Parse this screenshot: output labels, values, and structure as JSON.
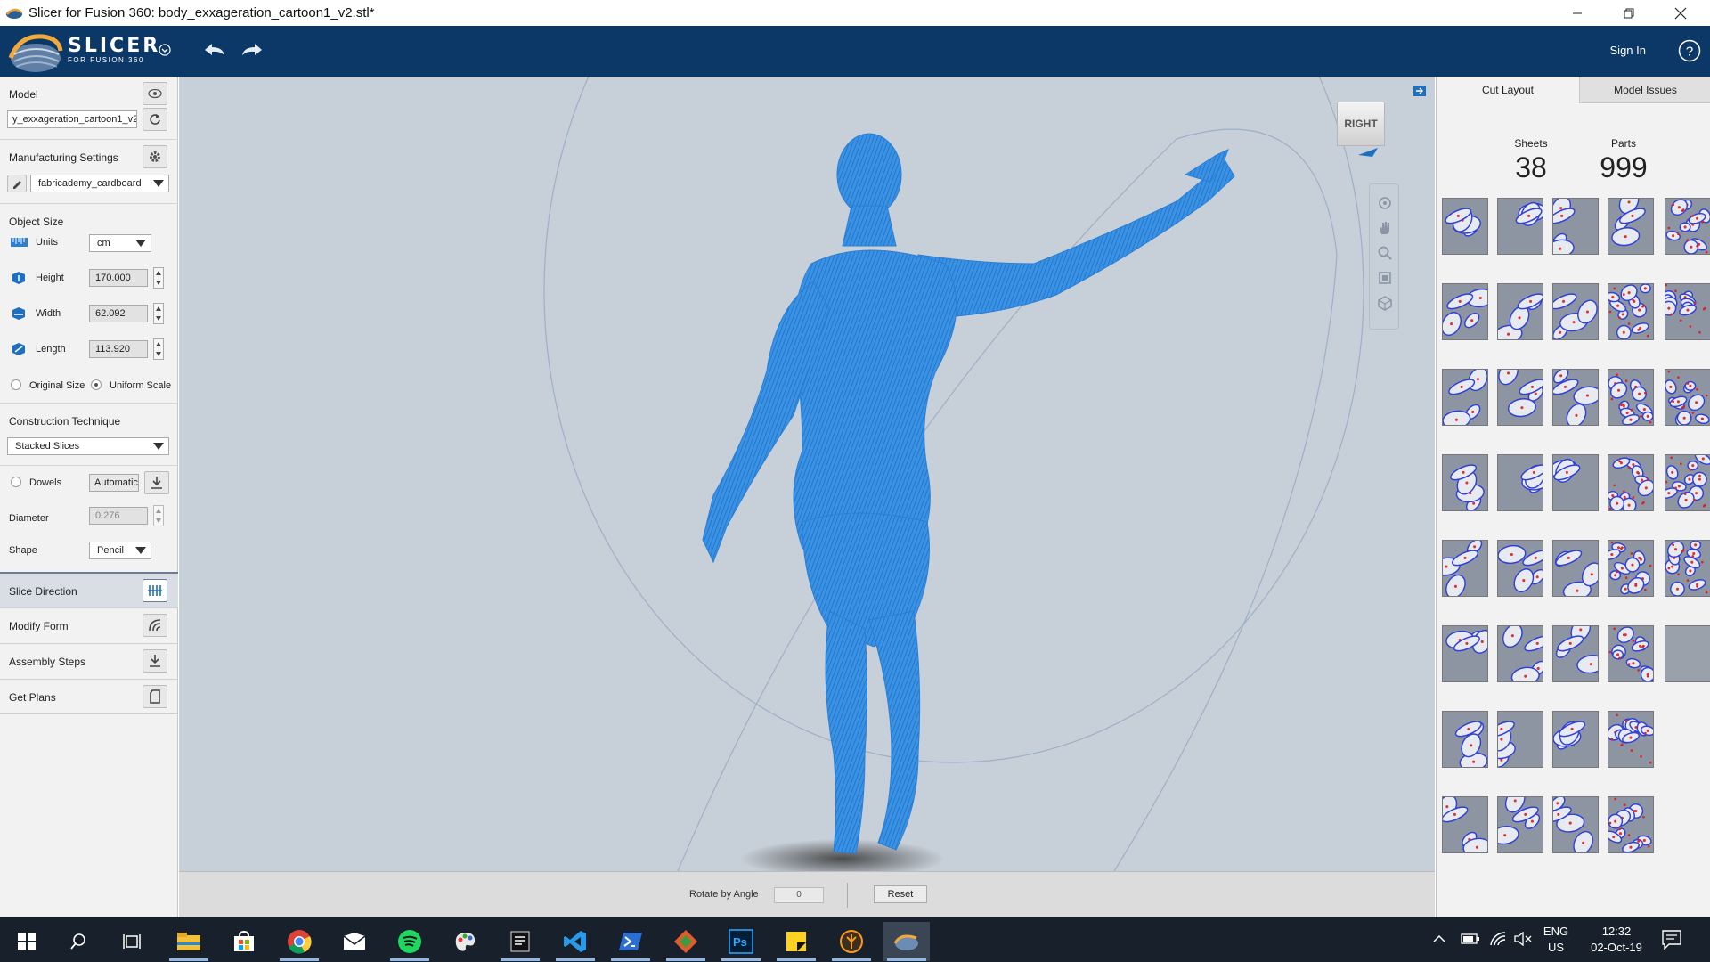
{
  "window": {
    "title": "Slicer for Fusion 360: body_exxageration_cartoon1_v2.stl*",
    "minimize_glyph": "—",
    "restore_glyph": "❐",
    "close_glyph": "✕"
  },
  "header": {
    "brand": "SLICER",
    "brand_sub": "FOR FUSION 360",
    "sign_in": "Sign In",
    "help_glyph": "?"
  },
  "left_panel": {
    "model_label": "Model",
    "model_file": "y_exxageration_cartoon1_v2",
    "manufacturing_label": "Manufacturing Settings",
    "material": "fabricademy_cardboard",
    "object_size_label": "Object Size",
    "units_label": "Units",
    "units_value": "cm",
    "height_label": "Height",
    "height_value": "170.000",
    "width_label": "Width",
    "width_value": "62.092",
    "length_label": "Length",
    "length_value": "113.920",
    "original_size_label": "Original Size",
    "uniform_scale_label": "Uniform Scale",
    "construction_label": "Construction Technique",
    "construction_value": "Stacked Slices",
    "dowels_label": "Dowels",
    "dowels_value": "Automatic",
    "diameter_label": "Diameter",
    "diameter_value": "0.276",
    "shape_label": "Shape",
    "shape_value": "Pencil",
    "steps": [
      {
        "label": "Slice Direction"
      },
      {
        "label": "Modify Form"
      },
      {
        "label": "Assembly Steps"
      },
      {
        "label": "Get Plans"
      }
    ]
  },
  "viewport": {
    "view_cube_label": "RIGHT",
    "rotate_label": "Rotate by  Angle",
    "angle_value": "0",
    "reset_label": "Reset"
  },
  "right_panel": {
    "tabs": [
      {
        "label": "Cut Layout",
        "active": true
      },
      {
        "label": "Model Issues",
        "active": false
      }
    ],
    "sheets_label": "Sheets",
    "sheets_value": "38",
    "parts_label": "Parts",
    "parts_value": "999"
  },
  "taskbar": {
    "apps": [
      "start-icon",
      "search-icon",
      "task-view-icon",
      "file-explorer-icon",
      "store-icon",
      "chrome-icon",
      "mail-icon",
      "spotify-icon",
      "paint-icon",
      "notepad-icon",
      "vscode-icon",
      "powershell-icon",
      "git-icon",
      "photoshop-icon",
      "sticky-notes-icon",
      "blender-icon",
      "slicer-icon"
    ],
    "lang": "ENG",
    "region": "US",
    "time": "12:32",
    "date": "02-Oct-19"
  },
  "colors": {
    "header_bg": "#0c3867",
    "viewport_bg": "#c7cfd8",
    "model_blue": "#2e8be0",
    "taskbar_bg": "#18202b"
  }
}
